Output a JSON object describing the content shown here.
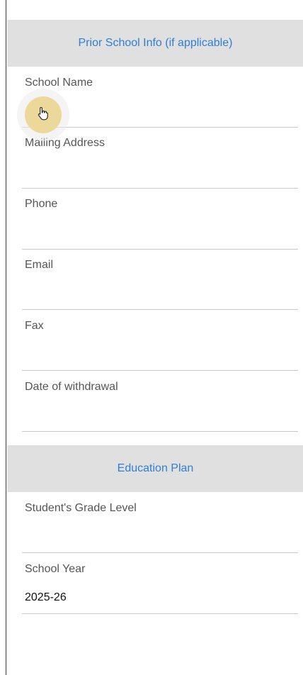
{
  "sections": {
    "prior_school": {
      "title": "Prior School Info (if applicable)",
      "fields": {
        "school_name": {
          "label": "School Name",
          "value": ""
        },
        "mailing_address": {
          "label": "Mailing Address",
          "value": ""
        },
        "phone": {
          "label": "Phone",
          "value": ""
        },
        "email": {
          "label": "Email",
          "value": ""
        },
        "fax": {
          "label": "Fax",
          "value": ""
        },
        "date_of_withdrawal": {
          "label": "Date of withdrawal",
          "value": ""
        }
      }
    },
    "education_plan": {
      "title": "Education Plan",
      "fields": {
        "grade_level": {
          "label": "Student's Grade Level",
          "value": ""
        },
        "school_year": {
          "label": "School Year",
          "value": "2025-26"
        }
      }
    }
  },
  "cursor": {
    "icon": "hand-pointer-icon",
    "highlight_color": "#ecd99a"
  },
  "colors": {
    "header_bg": "#e0e0e0",
    "header_text": "#2f7fd4",
    "label": "#555555",
    "divider": "#c8c8c8"
  }
}
